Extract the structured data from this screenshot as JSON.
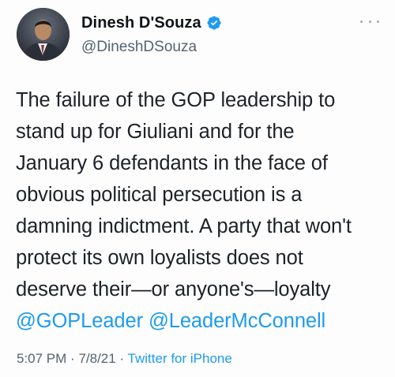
{
  "author": {
    "display_name": "Dinesh D'Souza",
    "handle": "@DineshDSouza",
    "verified": true,
    "avatar_icon": "profile-photo"
  },
  "tweet": {
    "lines": [
      "The failure of the GOP leadership to",
      "stand up for Giuliani and for the",
      "January 6 defendants in the face of",
      "obvious political persecution is a",
      "damning indictment. A party that won't",
      "protect its own loyalists does not",
      "deserve their—or anyone's—loyalty"
    ],
    "mentions": [
      "@GOPLeader",
      "@LeaderMcConnell"
    ]
  },
  "meta": {
    "time": "5:07 PM",
    "date": "7/8/21",
    "separator": "·",
    "source": "Twitter for iPhone"
  },
  "colors": {
    "link": "#1d9bf0",
    "secondary": "#536471",
    "text": "#0f1419"
  },
  "icons": {
    "verified": "verified-badge-icon",
    "more": "more-options-icon"
  }
}
